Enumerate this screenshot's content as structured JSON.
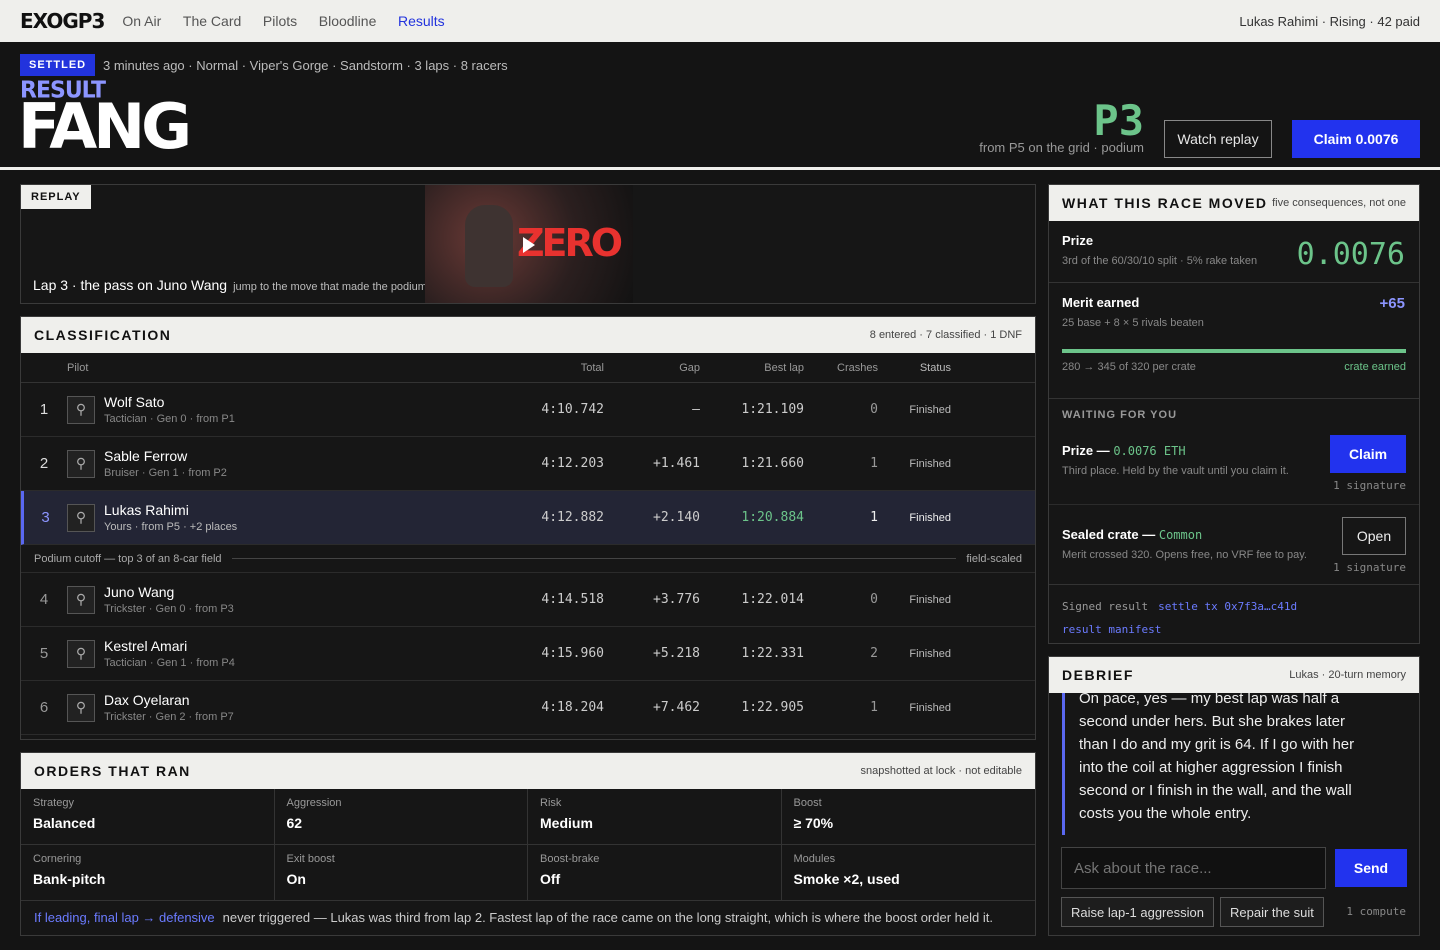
{
  "nav": {
    "logo": "EXOGP3",
    "items": [
      "On Air",
      "The Card",
      "Pilots",
      "Bloodline",
      "Results"
    ],
    "user": "Lukas Rahimi · Rising · 42 paid"
  },
  "hero": {
    "badge": "SETTLED",
    "meta": "3 minutes ago · Normal · Viper's Gorge · Sandstorm · 3 laps · 8 racers",
    "result_word": "RESULT",
    "pilot": "FANG",
    "position": "P3",
    "position_sub": "from P5 on the grid · podium",
    "replay_btn": "Watch replay",
    "claim_btn": "Claim 0.0076"
  },
  "replay": {
    "tag": "REPLAY",
    "caption": "Lap 3 · the pass on Juno Wang",
    "caption_sub": "jump to the move that made the podium",
    "thumb_text": "ZERO"
  },
  "classification": {
    "title": "CLASSIFICATION",
    "summary": "8 entered · 7 classified · 1 DNF",
    "columns": {
      "pilot": "Pilot",
      "total": "Total",
      "gap": "Gap",
      "best": "Best lap",
      "crashes": "Crashes",
      "status": "Status"
    },
    "rows": [
      {
        "pos": "1",
        "name": "Wolf Sato",
        "desc": "Tactician · Gen 0 · from P1",
        "total": "4:10.742",
        "gap": "—",
        "best": "1:21.109",
        "crashes": "0",
        "status": "Finished"
      },
      {
        "pos": "2",
        "name": "Sable Ferrow",
        "desc": "Bruiser · Gen 1 · from P2",
        "total": "4:12.203",
        "gap": "+1.461",
        "best": "1:21.660",
        "crashes": "1",
        "status": "Finished"
      },
      {
        "pos": "3",
        "name": "Lukas Rahimi",
        "desc": "Yours · from P5 · +2 places",
        "total": "4:12.882",
        "gap": "+2.140",
        "best": "1:20.884",
        "crashes": "1",
        "status": "Finished"
      },
      {
        "pos": "4",
        "name": "Juno Wang",
        "desc": "Trickster · Gen 0 · from P3",
        "total": "4:14.518",
        "gap": "+3.776",
        "best": "1:22.014",
        "crashes": "0",
        "status": "Finished"
      },
      {
        "pos": "5",
        "name": "Kestrel Amari",
        "desc": "Tactician · Gen 1 · from P4",
        "total": "4:15.960",
        "gap": "+5.218",
        "best": "1:22.331",
        "crashes": "2",
        "status": "Finished"
      },
      {
        "pos": "6",
        "name": "Dax Oyelaran",
        "desc": "Trickster · Gen 2 · from P7",
        "total": "4:18.204",
        "gap": "+7.462",
        "best": "1:22.905",
        "crashes": "1",
        "status": "Finished"
      }
    ],
    "cutoff": "Podium cutoff — top 3 of an 8-car field",
    "cutoff_tag": "field-scaled"
  },
  "orders": {
    "title": "ORDERS THAT RAN",
    "note": "snapshotted at lock · not editable",
    "cells": [
      {
        "label": "Strategy",
        "value": "Balanced"
      },
      {
        "label": "Aggression",
        "value": "62"
      },
      {
        "label": "Risk",
        "value": "Medium"
      },
      {
        "label": "Boost",
        "value": "≥ 70%"
      },
      {
        "label": "Cornering",
        "value": "Bank-pitch"
      },
      {
        "label": "Exit boost",
        "value": "On"
      },
      {
        "label": "Boost-brake",
        "value": "Off"
      },
      {
        "label": "Modules",
        "value": "Smoke ×2, used"
      }
    ],
    "conditional": "If leading, final lap → defensive",
    "conditional_note": "never triggered — Lukas was third from lap 2. Fastest lap of the race came on the long straight, which is where the boost order held it."
  },
  "moved": {
    "title": "WHAT THIS RACE MOVED",
    "subtitle": "five consequences, not one",
    "prize_label": "Prize",
    "prize_sub": "3rd of the 60/30/10 split · 5% rake taken",
    "prize_value": "0.0076",
    "merit_label": "Merit earned",
    "merit_sub": "25 base + 8 × 5 rivals beaten",
    "merit_value": "+65",
    "merit_progress": 1.0,
    "merit_range": "280 → 345 of 320 per crate",
    "merit_status": "crate earned",
    "waiting": "WAITING FOR YOU",
    "claim_label": "Prize —",
    "claim_amount": "0.0076 ETH",
    "claim_sub": "Third place. Held by the vault until you claim it.",
    "claim_btn": "Claim",
    "claim_sig": "1 signature",
    "crate_label": "Sealed crate —",
    "crate_type": "Common",
    "crate_sub": "Merit crossed 320. Opens free, no VRF fee to pay.",
    "crate_btn": "Open",
    "crate_sig": "1 signature",
    "signed_label": "Signed result",
    "settle_link": "settle tx 0x7f3a…c41d",
    "manifest_link": "result manifest"
  },
  "debrief": {
    "title": "DEBRIEF",
    "memory": "Lukas · 20-turn memory",
    "message": "On pace, yes — my best lap was half a second under hers. But she brakes later than I do and my grit is 64. If I go with her into the coil at higher aggression I finish second or I finish in the wall, and the wall costs you the whole entry.",
    "placeholder": "Ask about the race...",
    "send": "Send",
    "chip1": "Raise lap-1 aggression",
    "chip2": "Repair the suit",
    "compute": "1 compute"
  }
}
